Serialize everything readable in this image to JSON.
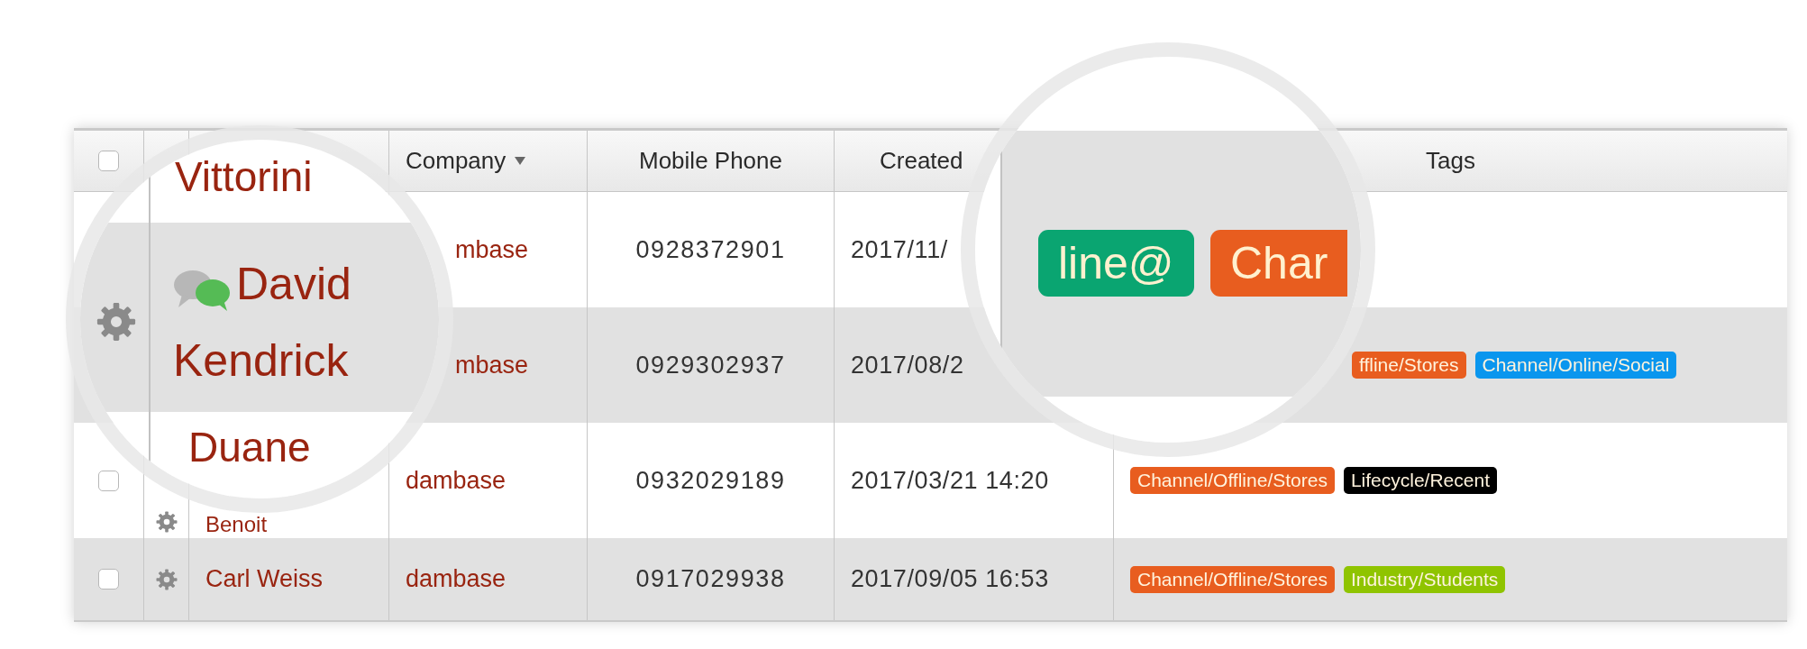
{
  "table": {
    "select_all": {
      "checked": false
    },
    "columns": [
      {
        "label": "Company",
        "sorted": true
      },
      {
        "label": "Mobile Phone",
        "sorted": false
      },
      {
        "label": "Created",
        "sorted": false
      },
      {
        "label": "Tags",
        "sorted": false
      }
    ],
    "rows": [
      {
        "company": "mbase",
        "phone": "0928372901",
        "created": "2017/11/"
      },
      {
        "company": "mbase",
        "phone": "0929302937",
        "created": "2017/08/2",
        "tags": [
          {
            "label": "ffline/Stores",
            "color": "#e85d1f"
          },
          {
            "label": "Channel/Online/Social",
            "color": "#0a96ee"
          }
        ]
      },
      {
        "checked": false,
        "settings": true,
        "name": "Benoit",
        "company": "dambase",
        "phone": "0932029189",
        "created": "2017/03/21 14:20",
        "tags": [
          {
            "label": "Channel/Offline/Stores",
            "color": "#e85d1f"
          },
          {
            "label": "Lifecycle/Recent",
            "color": "#000000"
          }
        ]
      },
      {
        "checked": false,
        "settings": true,
        "name": "Carl Weiss",
        "company": "dambase",
        "phone": "0917029938",
        "created": "2017/09/05 16:53",
        "tags": [
          {
            "label": "Channel/Offline/Stores",
            "color": "#e85d1f"
          },
          {
            "label": "Industry/Students",
            "color": "#8fc400"
          }
        ]
      }
    ]
  },
  "name_lens": {
    "header_name": "Vittorini",
    "settings": true,
    "chat": true,
    "name_lines": [
      "David",
      "Kendrick"
    ],
    "next_name": "Duane"
  },
  "tag_lens": {
    "tags": [
      {
        "label": "line@",
        "color": "#0aa571"
      },
      {
        "label": "Char",
        "color": "#e85d1f"
      }
    ]
  }
}
